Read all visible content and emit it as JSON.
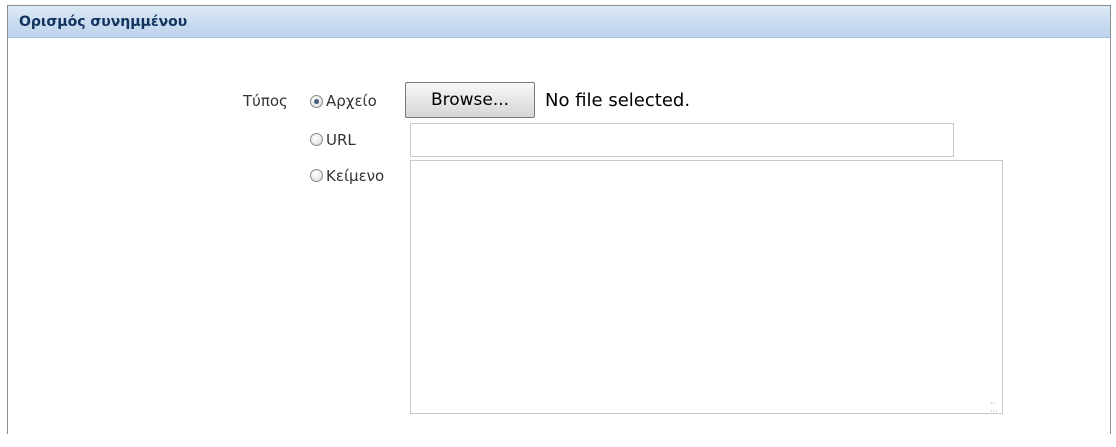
{
  "panel": {
    "title": "Ορισμός συνημμένου"
  },
  "form": {
    "type_label": "Τύπος",
    "options": [
      {
        "label": "Αρχείο",
        "checked": true
      },
      {
        "label": "URL",
        "checked": false
      },
      {
        "label": "Κείμενο",
        "checked": false
      }
    ],
    "file": {
      "browse_label": "Browse...",
      "status": "No file selected."
    },
    "url": {
      "value": ""
    },
    "text": {
      "value": ""
    }
  },
  "icons": {
    "resize": "resize-grip-icon"
  }
}
